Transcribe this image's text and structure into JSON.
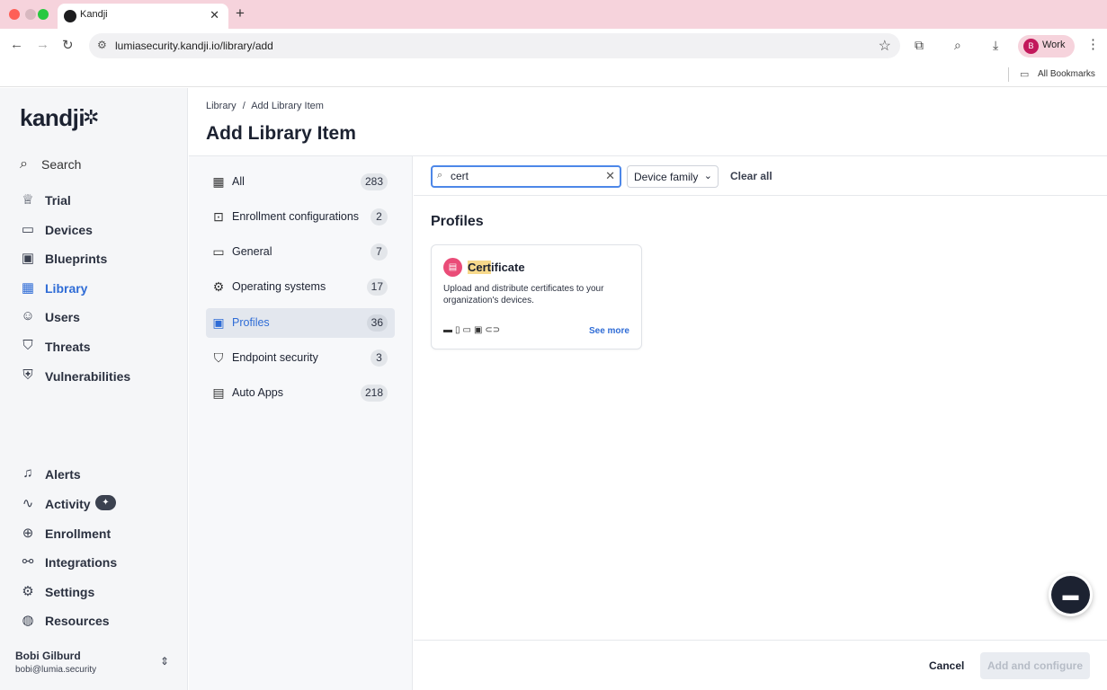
{
  "browser": {
    "tab_title": "Kandji",
    "url": "lumiasecurity.kandji.io/library/add",
    "profile_initial": "B",
    "profile_label": "Work",
    "bookmarks_label": "All Bookmarks"
  },
  "sidebar": {
    "logo": "kandji",
    "search_label": "Search",
    "items": [
      {
        "label": "Trial",
        "icon": "trophy-icon"
      },
      {
        "label": "Devices",
        "icon": "laptop-icon"
      },
      {
        "label": "Blueprints",
        "icon": "blueprint-icon"
      },
      {
        "label": "Library",
        "icon": "grid-icon",
        "active": true
      },
      {
        "label": "Users",
        "icon": "users-icon"
      },
      {
        "label": "Threats",
        "icon": "shield-icon"
      },
      {
        "label": "Vulnerabilities",
        "icon": "vulnerability-shield-icon"
      }
    ],
    "bottom_items": [
      {
        "label": "Alerts",
        "icon": "bell-icon"
      },
      {
        "label": "Activity",
        "icon": "activity-icon"
      },
      {
        "label": "Enrollment",
        "icon": "plus-circle-icon"
      },
      {
        "label": "Integrations",
        "icon": "share-nodes-icon"
      },
      {
        "label": "Settings",
        "icon": "gear-icon"
      },
      {
        "label": "Resources",
        "icon": "chart-icon"
      }
    ],
    "user": {
      "name": "Bobi Gilburd",
      "email": "bobi@lumia.security"
    }
  },
  "header": {
    "breadcrumb": [
      "Library",
      "/",
      "Add Library Item"
    ],
    "title": "Add Library Item"
  },
  "categories": [
    {
      "label": "All",
      "count": "283",
      "icon": "grid-icon"
    },
    {
      "label": "Enrollment configurations",
      "count": "2",
      "icon": "enrollment-icon"
    },
    {
      "label": "General",
      "count": "7",
      "icon": "folder-icon"
    },
    {
      "label": "Operating systems",
      "count": "17",
      "icon": "os-icon"
    },
    {
      "label": "Profiles",
      "count": "36",
      "icon": "profile-folder-icon",
      "selected": true
    },
    {
      "label": "Endpoint security",
      "count": "3",
      "icon": "shield-icon"
    },
    {
      "label": "Auto Apps",
      "count": "218",
      "icon": "apps-icon"
    }
  ],
  "filters": {
    "search_value": "cert",
    "device_family_label": "Device family",
    "clear_all_label": "Clear all"
  },
  "results": {
    "section_title": "Profiles",
    "card": {
      "title_highlight": "Cert",
      "title_rest": "ificate",
      "description": "Upload and distribute certificates to your organization's devices.",
      "see_more": "See more"
    }
  },
  "footer": {
    "cancel_label": "Cancel",
    "add_label": "Add and configure"
  },
  "colors": {
    "accent": "#2f6cd6",
    "tab_strip": "#f6d3dc",
    "certificate_icon": "#ea4c78"
  }
}
